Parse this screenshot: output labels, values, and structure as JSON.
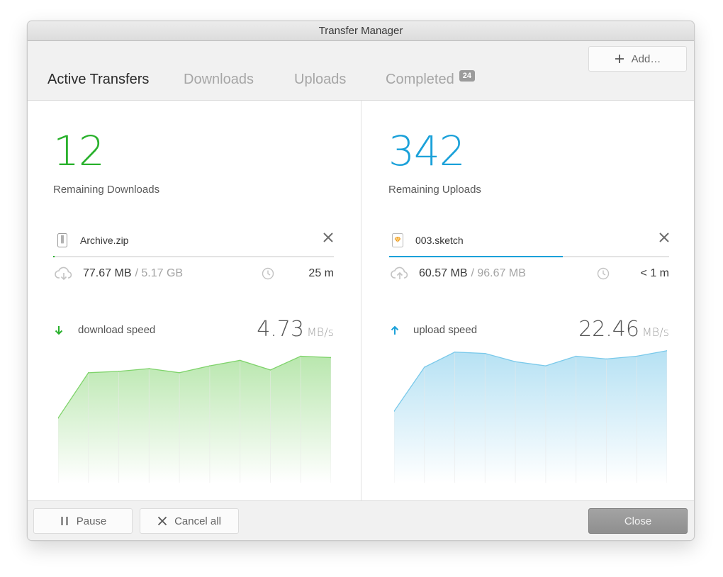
{
  "window": {
    "title": "Transfer Manager"
  },
  "toolbar": {
    "add_label": "Add…"
  },
  "tabs": [
    {
      "label": "Active Transfers",
      "active": true
    },
    {
      "label": "Downloads",
      "active": false
    },
    {
      "label": "Uploads",
      "active": false
    },
    {
      "label": "Completed",
      "active": false,
      "badge": "24"
    }
  ],
  "download": {
    "remaining_count": "12",
    "remaining_label": "Remaining Downloads",
    "file_name": "Archive.zip",
    "file_icon": "zip-file-icon",
    "progress_fraction": 0.005,
    "transferred": "77.67 MB",
    "total": "/ 5.17 GB",
    "time_left": "25 m",
    "speed_label": "download speed",
    "speed_value": "4.73",
    "speed_unit": "MB/s",
    "color": "#29b12c"
  },
  "upload": {
    "remaining_count": "342",
    "remaining_label": "Remaining Uploads",
    "file_name": "003.sketch",
    "file_icon": "sketch-file-icon",
    "progress_fraction": 0.62,
    "transferred": "60.57 MB",
    "total": "/ 96.67 MB",
    "time_left": "< 1 m",
    "speed_label": "upload speed",
    "speed_value": "22.46",
    "speed_unit": "MB/s",
    "color": "#1ba1d9"
  },
  "chart_data": [
    {
      "type": "area",
      "series": [
        {
          "values": [
            0.47,
            0.8,
            0.81,
            0.83,
            0.8,
            0.85,
            0.89,
            0.82,
            0.92,
            0.91
          ]
        }
      ],
      "ylim": [
        0,
        1
      ],
      "grid": true,
      "color": "#7fd36b"
    },
    {
      "type": "area",
      "series": [
        {
          "values": [
            0.52,
            0.84,
            0.95,
            0.94,
            0.88,
            0.85,
            0.92,
            0.9,
            0.92,
            0.96
          ]
        }
      ],
      "ylim": [
        0,
        1
      ],
      "grid": true,
      "color": "#7ac9ea"
    }
  ],
  "footer": {
    "pause_label": "Pause",
    "cancel_label": "Cancel all",
    "close_label": "Close"
  }
}
